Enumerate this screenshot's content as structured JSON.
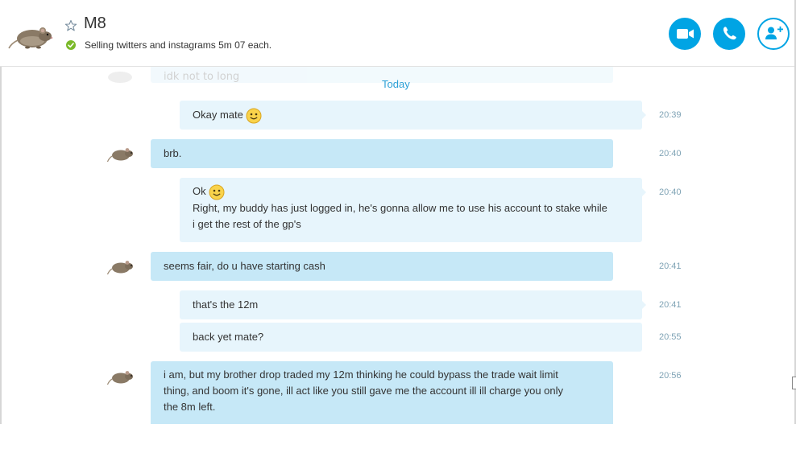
{
  "header": {
    "contact_name": "M8",
    "mood_message": "Selling twitters and instagrams 5m 07 each.",
    "status": "online",
    "icons": {
      "favorite": "star-outline-icon",
      "video": "video-camera-icon",
      "call": "phone-icon",
      "add_people": "add-person-icon"
    },
    "accent_color": "#00a4e4",
    "status_color": "#7ab929"
  },
  "conversation": {
    "previous_message": {
      "text": "idk not to long",
      "time": ""
    },
    "date_divider": "Today",
    "messages": [
      {
        "direction": "outgoing",
        "lines": [
          "Okay mate"
        ],
        "emoticon": "smile",
        "time": "20:39"
      },
      {
        "direction": "incoming",
        "lines": [
          "brb."
        ],
        "time": "20:40"
      },
      {
        "direction": "outgoing",
        "lines": [
          "Ok",
          "Right, my buddy has just logged in, he's gonna allow me to use his account to stake while",
          "i get the rest of the gp's"
        ],
        "emoticon": "smile",
        "time": "20:40"
      },
      {
        "direction": "incoming",
        "lines": [
          "seems fair, do u have starting cash"
        ],
        "time": "20:41"
      },
      {
        "direction": "outgoing",
        "lines": [
          "that's the 12m"
        ],
        "time": "20:41"
      },
      {
        "direction": "outgoing",
        "lines": [
          "back yet mate?"
        ],
        "time": "20:55"
      },
      {
        "direction": "incoming",
        "lines": [
          "i am, but my brother drop traded my 12m thinking he could bypass the trade wait limit",
          "thing, and boom it's gone, ill act like you still gave me the account ill ill charge you only",
          "the 8m left."
        ],
        "time": "20:56"
      }
    ],
    "colors": {
      "incoming_bubble": "#c6e8f7",
      "outgoing_bubble": "#e7f5fc",
      "date_divider": "#2a9fd6"
    }
  }
}
